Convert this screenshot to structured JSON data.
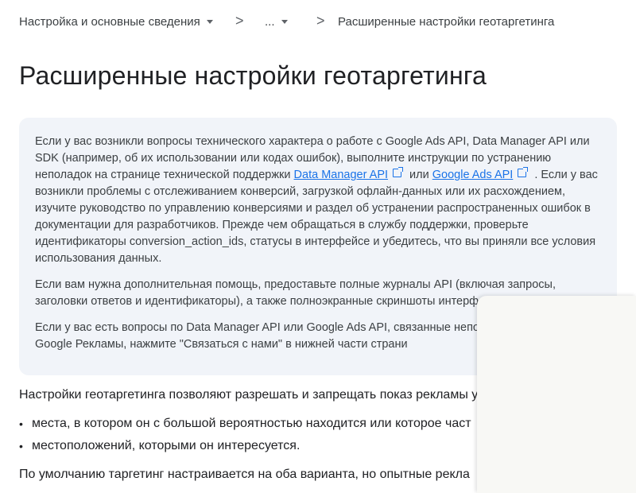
{
  "breadcrumb": {
    "item1": "Настройка и основные сведения",
    "separator": ">",
    "item2": "...",
    "item3": "Расширенные настройки геотаргетинга"
  },
  "page_title": "Расширенные настройки геотаргетинга",
  "notice": {
    "p1_part1": "Если у вас возникли вопросы технического характера о работе с Google Ads API, Data Manager API или SDK (например, об их использовании или кодах ошибок), выполните инструкции по устранению неполадок на странице технической поддержки ",
    "link_dm": "Data Manager API",
    "p1_or": " или ",
    "link_ads": "Google Ads API",
    "p1_part2": " . Если у вас возникли проблемы с отслеживанием конверсий, загрузкой офлайн-данных или их расхождением, изучите руководство по управлению конверсиями и раздел об устранении распространенных ошибок в документации для разработчиков. Прежде чем обращаться в службу поддержки, проверьте идентификаторы conversion_action_ids, статусы в интерфейсе и убедитесь, что вы приняли все условия использования данных.",
    "p2": "Если вам нужна дополнительная помощь, предоставьте полные журналы API (включая запросы, заголовки ответов и идентификаторы), а также полноэкранные скриншоты интерфейса Google Р",
    "p3": "Если у вас есть вопросы по Data Manager API или Google Ads API, связанные непоср интерфейсом Google Рекламы, нажмите \"Связаться с нами\" в нижней части страни"
  },
  "body": {
    "intro": "Настройки геотаргетинга позволяют разрешать и запрещать показ рекламы учетом:",
    "bullets": [
      "места, в котором он с большой вероятностью находится или которое част",
      "местоположений, которыми он интересуется."
    ],
    "last_line": "По умолчанию таргетинг настраивается на оба варианта, но опытные рекла"
  }
}
